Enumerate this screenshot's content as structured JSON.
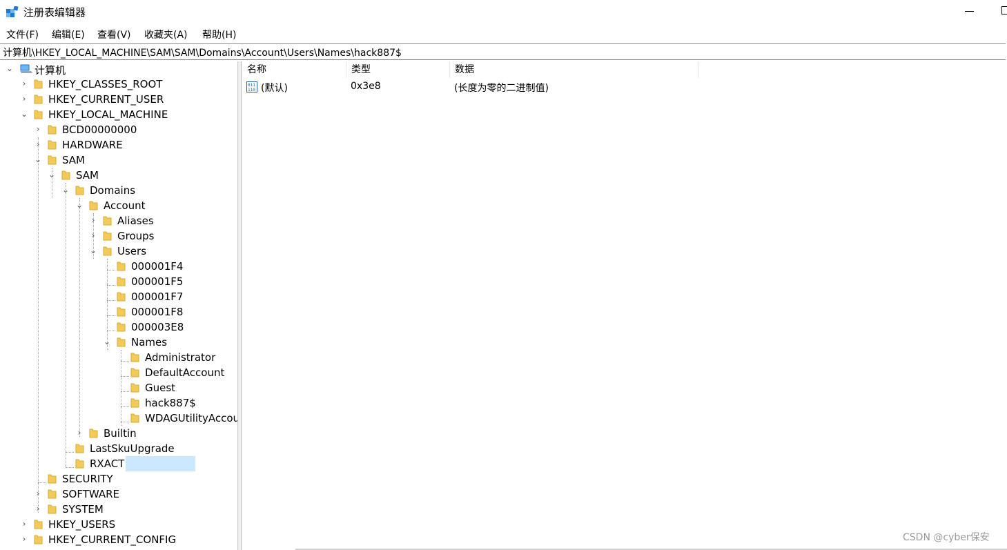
{
  "window": {
    "title": "注册表编辑器"
  },
  "menu": {
    "file": "文件(F)",
    "edit": "编辑(E)",
    "view": "查看(V)",
    "favorites": "收藏夹(A)",
    "help": "帮助(H)"
  },
  "address": {
    "path": "计算机\\HKEY_LOCAL_MACHINE\\SAM\\SAM\\Domains\\Account\\Users\\Names\\hack887$"
  },
  "tree": {
    "root": "计算机",
    "hkcr": "HKEY_CLASSES_ROOT",
    "hkcu": "HKEY_CURRENT_USER",
    "hklm": "HKEY_LOCAL_MACHINE",
    "bcd": "BCD00000000",
    "hardware": "HARDWARE",
    "sam": "SAM",
    "sam2": "SAM",
    "domains": "Domains",
    "account": "Account",
    "aliases": "Aliases",
    "groups": "Groups",
    "users": "Users",
    "u1f4": "000001F4",
    "u1f5": "000001F5",
    "u1f7": "000001F7",
    "u1f8": "000001F8",
    "u3e8": "000003E8",
    "names": "Names",
    "administrator": "Administrator",
    "defaultaccount": "DefaultAccount",
    "guest": "Guest",
    "hack": "hack887$",
    "wdag": "WDAGUtilityAccount",
    "builtin": "Builtin",
    "lastsku": "LastSkuUpgrade",
    "rxact": "RXACT",
    "security": "SECURITY",
    "software": "SOFTWARE",
    "system": "SYSTEM",
    "hku": "HKEY_USERS",
    "hkcc": "HKEY_CURRENT_CONFIG"
  },
  "list": {
    "headers": {
      "name": "名称",
      "type": "类型",
      "data": "数据"
    },
    "rows": [
      {
        "name": "(默认)",
        "type": "0x3e8",
        "data": "(长度为零的二进制值)"
      }
    ]
  },
  "watermark": "CSDN @cyber保安",
  "colors": {
    "folder": "#f3c95a",
    "selection": "#cce8ff",
    "accent": "#1e78d6"
  }
}
